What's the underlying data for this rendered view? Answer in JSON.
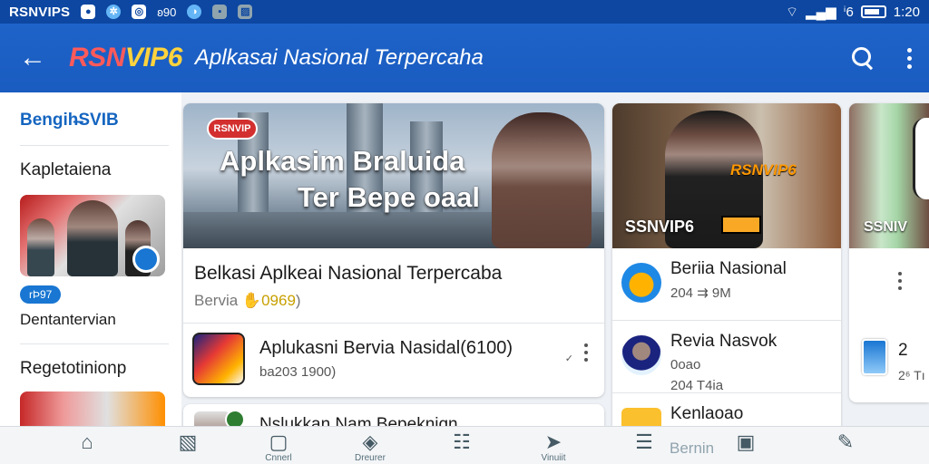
{
  "status_bar": {
    "app_name": "RSNVIPS",
    "icons": [
      "notification-icon",
      "gear-icon",
      "camera-icon",
      "sim-icon",
      "settings-round-icon",
      "gallery-icon",
      "photo-icon"
    ],
    "mid_text": "ʚ90",
    "signal_text": "ⁱ6",
    "time": "1:20"
  },
  "app_bar": {
    "brand_part1": "RSN",
    "brand_part2": "VIP6",
    "title": "Aplkasai Nasional Terpercaha",
    "colors": {
      "background": "#1e63c9",
      "brand_red": "#ff5a5a",
      "brand_yellow": "#ffd33d"
    }
  },
  "sidebar": {
    "brand": "Bengih̶SVIB",
    "heading1": "Kapletaiena",
    "pill": "rÞ97",
    "caption": "Dentantervian",
    "heading2": "Regetotinionp"
  },
  "main_card": {
    "chip": "RSNVIP",
    "hero_title_line1": "Aplkasim Braluida",
    "hero_title_line2": "Ter Bepe oaal",
    "headline": "Belkasi Aplkeai Nasional Terpercaba",
    "sub_prefix": "Bervia",
    "sub_highlight": "✋0969",
    "sub_suffix": ")",
    "row": {
      "title": "Aplukasni Bervia Nasidal(6100)",
      "meta": "ba203 1900)"
    },
    "peek_title": "Nslukkan Nam Bepekniqn"
  },
  "mid_card": {
    "brand_strip": "RSNVIP6",
    "hero_label": "SSNVIP6",
    "rows": [
      {
        "title": "Beriia Nasional",
        "meta": "204 ⇉ 9M"
      },
      {
        "title": "Revia Nasvok",
        "meta": "0oao",
        "meta2": "204 T4ia"
      },
      {
        "title": "Kenlaoao",
        "meta": ""
      }
    ]
  },
  "right_card": {
    "hero_label": "SSNIV",
    "num": "2",
    "num2": "2⁶ Tı"
  },
  "bottom_nav": {
    "items": [
      {
        "icon": "home-icon",
        "glyph": "⌂",
        "label": ""
      },
      {
        "icon": "gallery-icon",
        "glyph": "▧",
        "label": ""
      },
      {
        "icon": "card-icon",
        "glyph": "▢",
        "label": "Cnnerl"
      },
      {
        "icon": "box-icon",
        "glyph": "◈",
        "label": "Dreurer"
      },
      {
        "icon": "list-icon",
        "glyph": "☷",
        "label": ""
      },
      {
        "icon": "send-icon",
        "glyph": "➤",
        "label": "Vinuiit"
      },
      {
        "icon": "document-icon",
        "glyph": "☰",
        "label": ""
      },
      {
        "icon": "folder-icon",
        "glyph": "▣",
        "label": ""
      },
      {
        "icon": "pen-icon",
        "glyph": "✎",
        "label": ""
      }
    ],
    "inline_label": "Bernin"
  }
}
